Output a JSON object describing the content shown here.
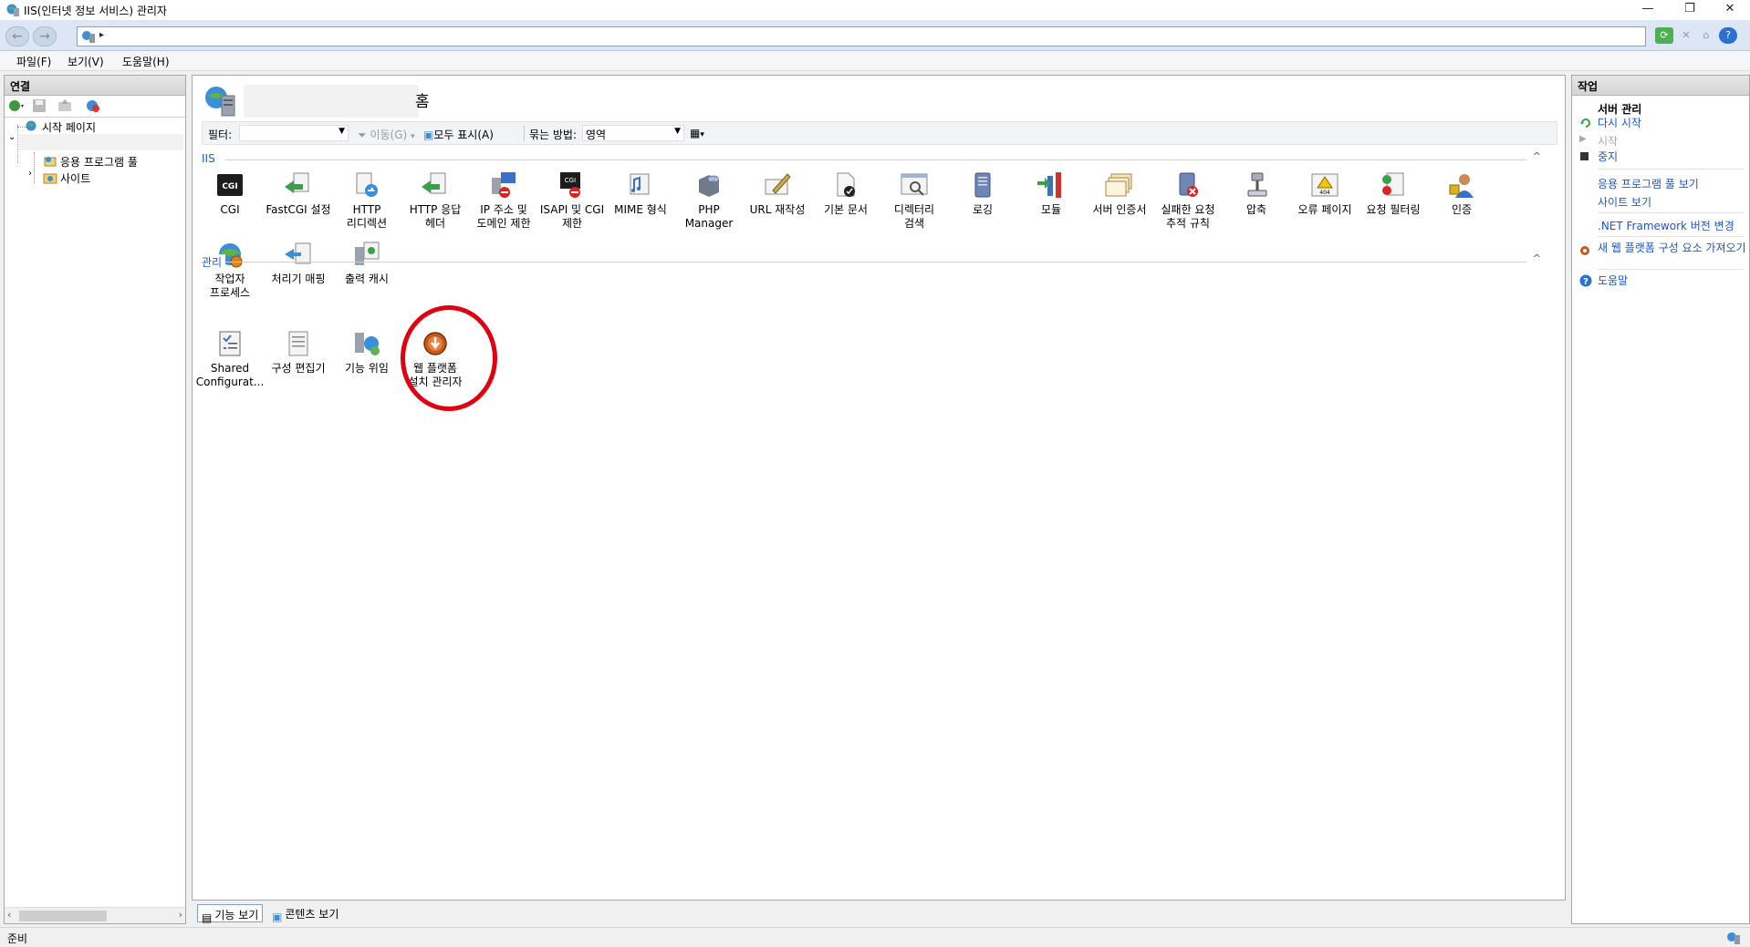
{
  "window": {
    "title": "IIS(인터넷 정보 서비스) 관리자",
    "minimize": "—",
    "restore": "❐",
    "close": "✕"
  },
  "address": {
    "back": "←",
    "forward": "→",
    "arrow": "▸"
  },
  "menu": {
    "items": [
      "파일(F)",
      "보기(V)",
      "도움말(H)"
    ]
  },
  "connections": {
    "title": "연결",
    "tree": {
      "start_page": "시작 페이지",
      "app_pools": "응용 프로그램 풀",
      "sites": "사이트"
    }
  },
  "content": {
    "home_suffix": "홈",
    "filter_label": "필터:",
    "go_label": "이동(G)",
    "show_all_label": "모두 표시(A)",
    "group_by_label": "묶는 방법:",
    "group_by_value": "영역",
    "groups": [
      {
        "name": "IIS",
        "features": [
          {
            "label": "CGI",
            "icon": "cgi-icon"
          },
          {
            "label": "FastCGI 설정",
            "icon": "fastcgi-icon"
          },
          {
            "label": "HTTP\n리디렉션",
            "icon": "http-redirect-icon"
          },
          {
            "label": "HTTP 응답\n헤더",
            "icon": "http-response-headers-icon"
          },
          {
            "label": "IP 주소 및\n도메인 제한",
            "icon": "ip-restrictions-icon"
          },
          {
            "label": "ISAPI 및 CGI\n제한",
            "icon": "isapi-cgi-icon"
          },
          {
            "label": "MIME 형식",
            "icon": "mime-icon"
          },
          {
            "label": "PHP\nManager",
            "icon": "php-icon"
          },
          {
            "label": "URL 재작성",
            "icon": "url-rewrite-icon"
          },
          {
            "label": "기본 문서",
            "icon": "default-document-icon"
          },
          {
            "label": "디렉터리\n검색",
            "icon": "directory-browsing-icon"
          },
          {
            "label": "로깅",
            "icon": "logging-icon"
          },
          {
            "label": "모듈",
            "icon": "modules-icon"
          },
          {
            "label": "서버 인증서",
            "icon": "server-certificates-icon"
          },
          {
            "label": "실패한 요청\n추적 규칙",
            "icon": "failed-request-tracing-icon"
          },
          {
            "label": "압축",
            "icon": "compression-icon"
          },
          {
            "label": "오류 페이지",
            "icon": "error-pages-icon"
          },
          {
            "label": "요청 필터링",
            "icon": "request-filtering-icon"
          },
          {
            "label": "인증",
            "icon": "authentication-icon"
          },
          {
            "label": "작업자\n프로세스",
            "icon": "worker-processes-icon"
          },
          {
            "label": "처리기 매핑",
            "icon": "handler-mappings-icon"
          },
          {
            "label": "출력 캐시",
            "icon": "output-caching-icon"
          }
        ]
      },
      {
        "name": "관리",
        "features": [
          {
            "label": "Shared\nConfigurat...",
            "icon": "shared-configuration-icon"
          },
          {
            "label": "구성 편집기",
            "icon": "configuration-editor-icon"
          },
          {
            "label": "기능 위임",
            "icon": "feature-delegation-icon"
          },
          {
            "label": "웹 플랫폼\n설치 관리자",
            "icon": "web-platform-installer-icon"
          }
        ]
      }
    ],
    "collapse_glyph": "^"
  },
  "bottom_tabs": {
    "features_view": "기능 보기",
    "content_view": "콘텐츠 보기"
  },
  "actions": {
    "title": "작업",
    "section": "서버 관리",
    "items": {
      "restart": "다시 시작",
      "start": "시작",
      "stop": "중지",
      "view_app_pools": "응용 프로그램 풀 보기",
      "view_sites": "사이트 보기",
      "net_framework": ".NET Framework 버전 변경",
      "get_components": "새 웹 플랫폼 구성 요소 가져오기",
      "help": "도움말"
    }
  },
  "status": {
    "text": "준비"
  },
  "colors": {
    "link": "#1a56d6",
    "highlight": "#e00010"
  }
}
